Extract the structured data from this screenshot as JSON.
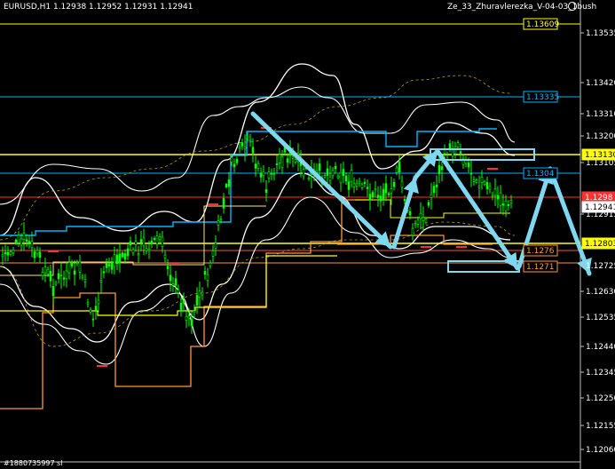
{
  "header": {
    "symbol_line": "EURUSD,H1  1.12938  1.12952  1.12931  1.12941",
    "indicator_name": "Ze_33_Zhuravlerezka_V-04-03_1bush"
  },
  "footer": {
    "text": "#1880735997 sl"
  },
  "colors": {
    "background": "#000000",
    "candle": "#00ff00",
    "bands": "#ffffff",
    "level_cyan": "#00b4ff",
    "level_yellow": "#ffff00",
    "level_orange": "#ff9933",
    "level_red": "#ff3030",
    "arrows": "#7fd8f0"
  },
  "chart_data": {
    "type": "candlestick",
    "instrument": "EURUSD",
    "timeframe": "H1",
    "ohlc": {
      "open": 1.12938,
      "high": 1.12952,
      "low": 1.12931,
      "close": 1.12941
    },
    "y_ticks": [
      "1.13535",
      "1.13420",
      "1.13310",
      "1.13200",
      "1.13105",
      "1.12915",
      "1.12725",
      "1.12630",
      "1.12535",
      "1.12440",
      "1.12345",
      "1.12250",
      "1.12155",
      "1.12060"
    ],
    "price_tags": [
      {
        "text": "1.13609",
        "style": "yellow-box"
      },
      {
        "text": "1.13335",
        "style": "cyan-box"
      },
      {
        "text": "1.13130",
        "style": "yellow-fill"
      },
      {
        "text": "1.1304",
        "style": "cyan-box"
      },
      {
        "text": "1.1298",
        "style": "red-fill"
      },
      {
        "text": "1.12941",
        "style": "white-fill"
      },
      {
        "text": "1.12803",
        "style": "yellow-fill"
      },
      {
        "text": "1.1276",
        "style": "orange-box"
      },
      {
        "text": "1.1271",
        "style": "orange-box"
      }
    ],
    "ylim": [
      1.12,
      1.137
    ],
    "grid": false
  }
}
